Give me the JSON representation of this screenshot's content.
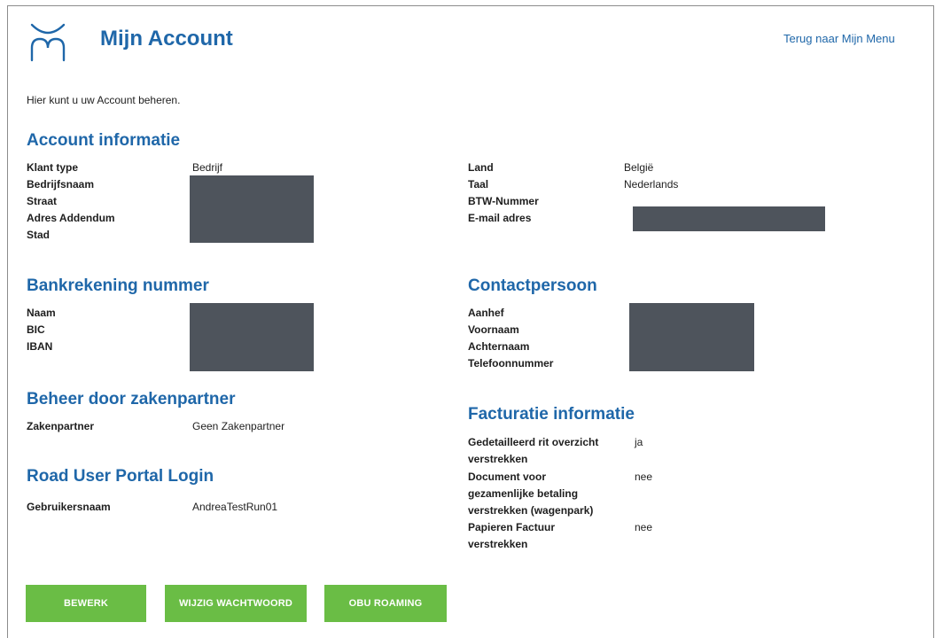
{
  "header": {
    "title": "Mijn Account",
    "back_link": "Terug naar Mijn Menu"
  },
  "intro": "Hier kunt u uw Account beheren.",
  "account_info": {
    "heading": "Account informatie",
    "left_labels": [
      "Klant type",
      "Bedrijfsnaam",
      "Straat",
      "Adres Addendum",
      "Stad"
    ],
    "klant_type": "Bedrijf",
    "right_labels": [
      "Land",
      "Taal",
      "BTW-Nummer",
      "E-mail adres"
    ],
    "land": "België",
    "taal": "Nederlands"
  },
  "bank": {
    "heading": "Bankrekening nummer",
    "labels": [
      "Naam",
      "BIC",
      "IBAN"
    ]
  },
  "contact": {
    "heading": "Contactpersoon",
    "labels": [
      "Aanhef",
      "Voornaam",
      "Achternaam",
      "Telefoonnummer"
    ]
  },
  "partner": {
    "heading": "Beheer door zakenpartner",
    "label": "Zakenpartner",
    "value": "Geen Zakenpartner"
  },
  "portal": {
    "heading": "Road User Portal Login",
    "label": "Gebruikersnaam",
    "value": "AndreaTestRun01"
  },
  "billing": {
    "heading": "Facturatie informatie",
    "rows": [
      {
        "label_lines": [
          "Gedetailleerd rit overzicht",
          "verstrekken"
        ],
        "value": "ja"
      },
      {
        "label_lines": [
          "Document voor",
          "gezamenlijke betaling",
          "verstrekken (wagenpark)"
        ],
        "value": "nee"
      },
      {
        "label_lines": [
          "Papieren Factuur",
          "verstrekken"
        ],
        "value": "nee"
      }
    ]
  },
  "buttons": {
    "edit": "BEWERK",
    "change_password": "WIJZIG WACHTWOORD",
    "obu_roaming": "OBU ROAMING"
  },
  "colors": {
    "heading_blue": "#1f67a9",
    "button_green": "#6abd45",
    "redaction": "#4e545c"
  }
}
